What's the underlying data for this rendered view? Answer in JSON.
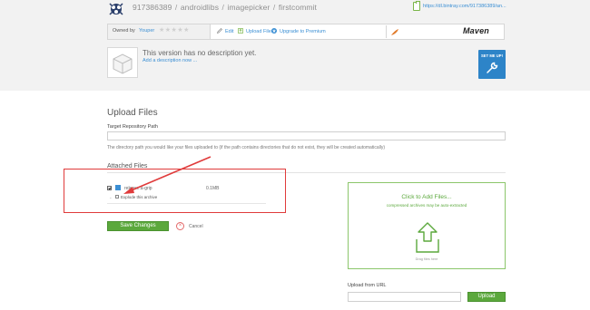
{
  "header": {
    "breadcrumb": [
      "917386389",
      "androidlibs",
      "imagepicker",
      "firstcommit"
    ],
    "download_link": "https://dl.bintray.com/917386389/an...",
    "owned_by_label": "Owned by",
    "owner": "Youper",
    "toolbar": {
      "edit_label": "Edit",
      "upload_files_label": "Upload Files",
      "upgrade_label": "Upgrade to Premium"
    },
    "maven_logo": "Maven",
    "no_description": "This version has no description yet.",
    "add_description": "Add a description now ...",
    "set_me_up": "SET ME UP!",
    "icons": {
      "avatar": "avatar-icon",
      "clip": "clipboard-icon",
      "edit": "pencil-icon",
      "upload": "upload-icon",
      "upgrade": "star-circle-icon",
      "package": "package-box-icon",
      "set_me_up": "wrench-icon"
    }
  },
  "main": {
    "title": "Upload Files",
    "target_path_label": "Target Repository Path",
    "target_path_value": "",
    "help_text": "The directory path you would like your files uploaded to (if the path contains directories that do not exist, they will be created automatically)",
    "attached_title": "Attached Files",
    "files": [
      {
        "name": "release.a-grip",
        "size": "0.1MB",
        "checked": true
      }
    ],
    "explode_label": "Explode this archive",
    "save_label": "Save Changes",
    "cancel_label": "Cancel"
  },
  "dropzone": {
    "title": "Click to Add Files...",
    "subtitle": "compressed archives may be auto-extracted",
    "hint": "Drag files here"
  },
  "upload_url": {
    "label": "Upload from URL",
    "value": "",
    "button": "Upload"
  },
  "colors": {
    "accent_green": "#5ba83c",
    "link_blue": "#3b8fd4",
    "annotation_red": "#e03b3b",
    "header_gray": "#f2f2f2"
  }
}
